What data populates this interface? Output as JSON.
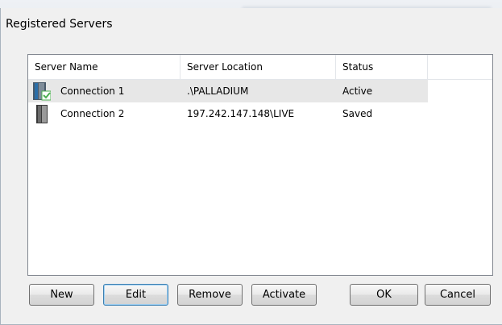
{
  "window": {
    "title": "Registered Servers"
  },
  "list": {
    "columns": [
      "Server Name",
      "Server Location",
      "Status"
    ],
    "rows": [
      {
        "name": "Connection 1",
        "location": ".\\PALLADIUM",
        "status": "Active",
        "icon": "server-active-icon"
      },
      {
        "name": "Connection 2",
        "location": "197.242.147.148\\LIVE",
        "status": "Saved",
        "icon": "server-icon"
      }
    ]
  },
  "buttons": {
    "new": "New",
    "edit": "Edit",
    "remove": "Remove",
    "activate": "Activate",
    "ok": "OK",
    "cancel": "Cancel"
  },
  "colors": {
    "selected_row": "#e7e7e7",
    "focus_border": "#3c7fb1",
    "active_check": "#4caf50"
  }
}
